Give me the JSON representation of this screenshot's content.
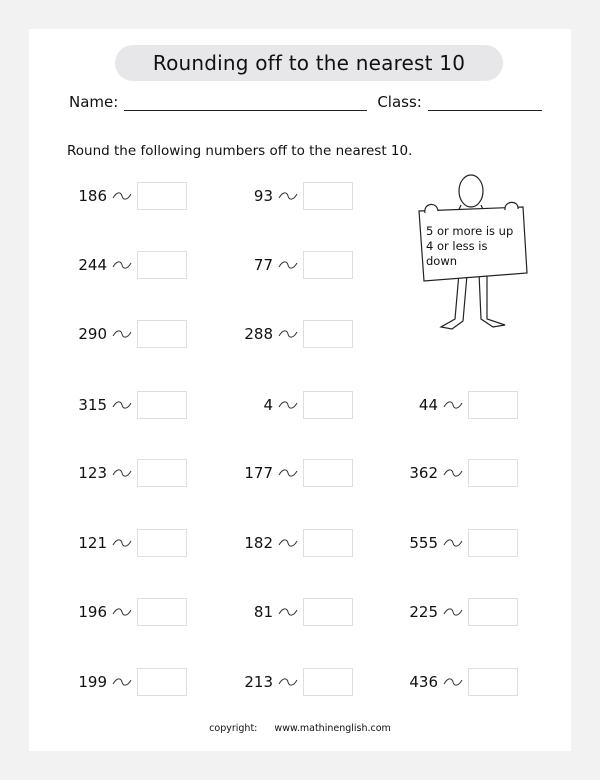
{
  "title": "Rounding off to the nearest 10",
  "name_label": "Name:",
  "class_label": "Class:",
  "instructions": "Round the following numbers off to the nearest 10.",
  "sign": {
    "line1": "5 or more is up",
    "line2": "4 or less is down"
  },
  "problems": [
    {
      "number": "186",
      "answer": ""
    },
    {
      "number": "93",
      "answer": ""
    },
    {
      "number": "244",
      "answer": ""
    },
    {
      "number": "77",
      "answer": ""
    },
    {
      "number": "290",
      "answer": ""
    },
    {
      "number": "288",
      "answer": ""
    },
    {
      "number": "315",
      "answer": ""
    },
    {
      "number": "4",
      "answer": ""
    },
    {
      "number": "44",
      "answer": ""
    },
    {
      "number": "123",
      "answer": ""
    },
    {
      "number": "177",
      "answer": ""
    },
    {
      "number": "362",
      "answer": ""
    },
    {
      "number": "121",
      "answer": ""
    },
    {
      "number": "182",
      "answer": ""
    },
    {
      "number": "555",
      "answer": ""
    },
    {
      "number": "196",
      "answer": ""
    },
    {
      "number": "81",
      "answer": ""
    },
    {
      "number": "225",
      "answer": ""
    },
    {
      "number": "199",
      "answer": ""
    },
    {
      "number": "213",
      "answer": ""
    },
    {
      "number": "436",
      "answer": ""
    }
  ],
  "footer": {
    "copyright_label": "copyright:",
    "website": "www.mathinenglish.com"
  }
}
